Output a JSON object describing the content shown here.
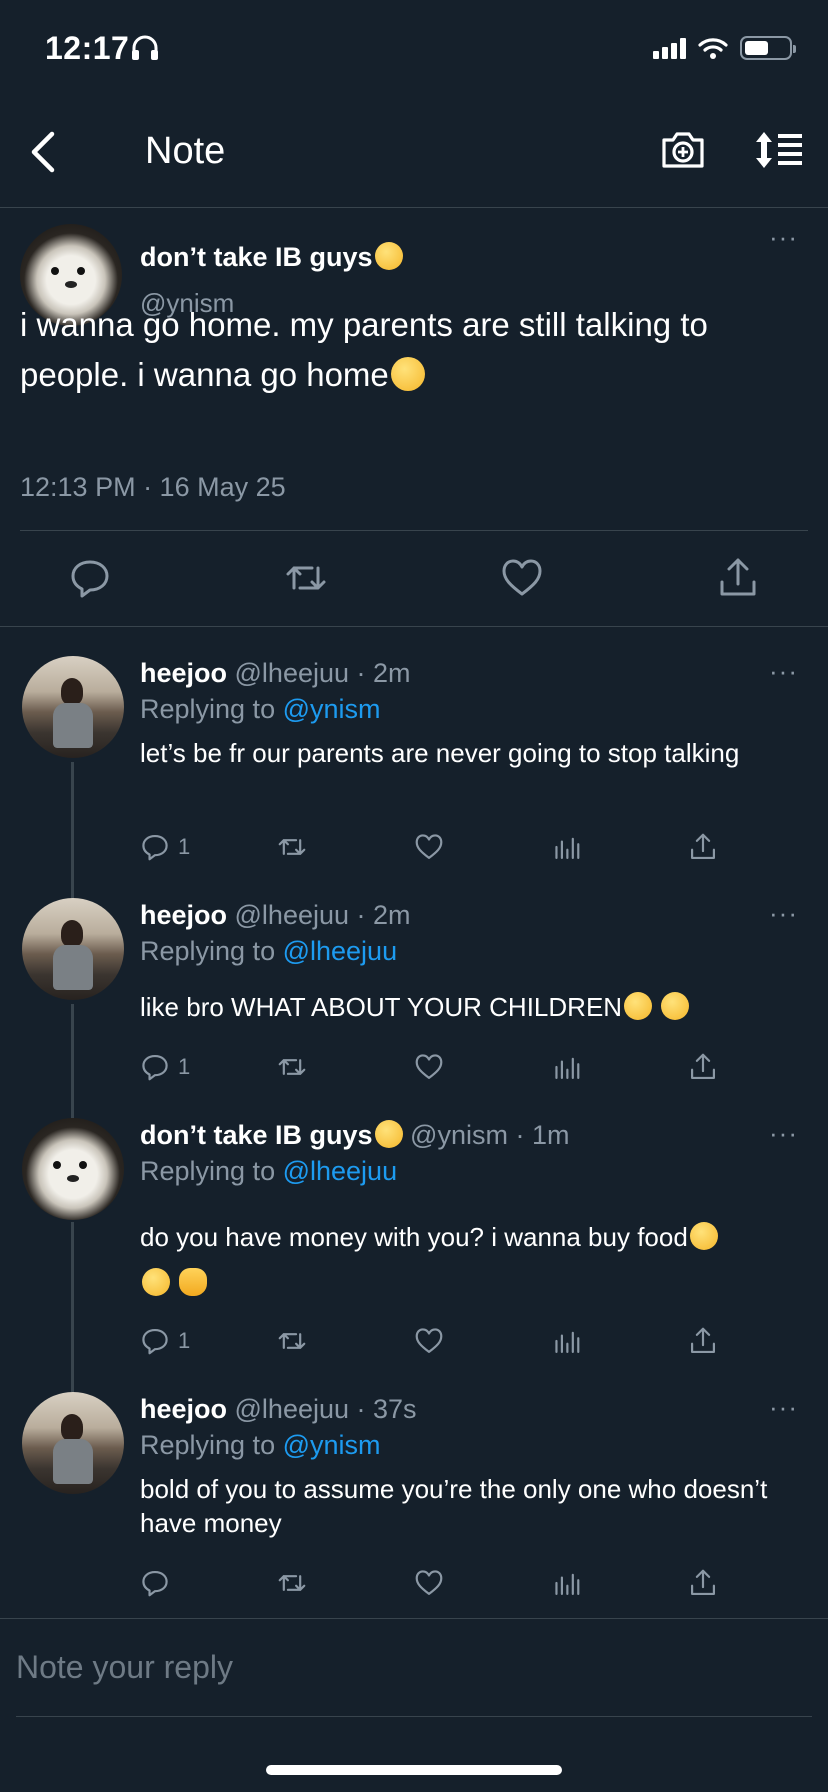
{
  "status_bar": {
    "time": "12:17"
  },
  "nav": {
    "title": "Note"
  },
  "main_tweet": {
    "name": "don’t take IB guys",
    "handle": "@ynism",
    "text": "i wanna go home. my parents are still talking to people. i wanna go home",
    "timestamp": "12:13 PM · 16 May 25",
    "more": "···"
  },
  "replies": [
    {
      "name": "heejoo",
      "meta": " @lheejuu · 2m",
      "replying_label": "Replying to ",
      "replying_handle": "@ynism",
      "text": "let’s be fr our parents are never going to stop talking",
      "reply_count": "1",
      "more": "···"
    },
    {
      "name": "heejoo",
      "meta": " @lheejuu · 2m",
      "replying_label": "Replying to ",
      "replying_handle": "@lheejuu",
      "text": "like bro WHAT ABOUT YOUR CHILDREN",
      "reply_count": "1",
      "more": "···"
    },
    {
      "name": "don’t take IB guys",
      "meta": "  @ynism · 1m",
      "replying_label": "Replying to ",
      "replying_handle": "@lheejuu",
      "text": "do you have money with you? i wanna buy food",
      "reply_count": "1",
      "more": "···"
    },
    {
      "name": "heejoo",
      "meta": " @lheejuu · 37s",
      "replying_label": "Replying to ",
      "replying_handle": "@ynism",
      "text": "bold of you to assume you’re the only one who doesn’t have money",
      "reply_count": "",
      "more": "···"
    }
  ],
  "composer": {
    "placeholder": "Note your reply"
  },
  "colors": {
    "background": "#15202b",
    "accent": "#1d9bf0",
    "muted": "#8b98a5",
    "divider": "#38444d"
  },
  "icons": [
    "back-icon",
    "camera-icon",
    "sort-icon",
    "reply-icon",
    "retweet-icon",
    "like-icon",
    "share-icon",
    "analytics-icon",
    "headphones-icon",
    "wifi-icon",
    "battery-icon"
  ]
}
